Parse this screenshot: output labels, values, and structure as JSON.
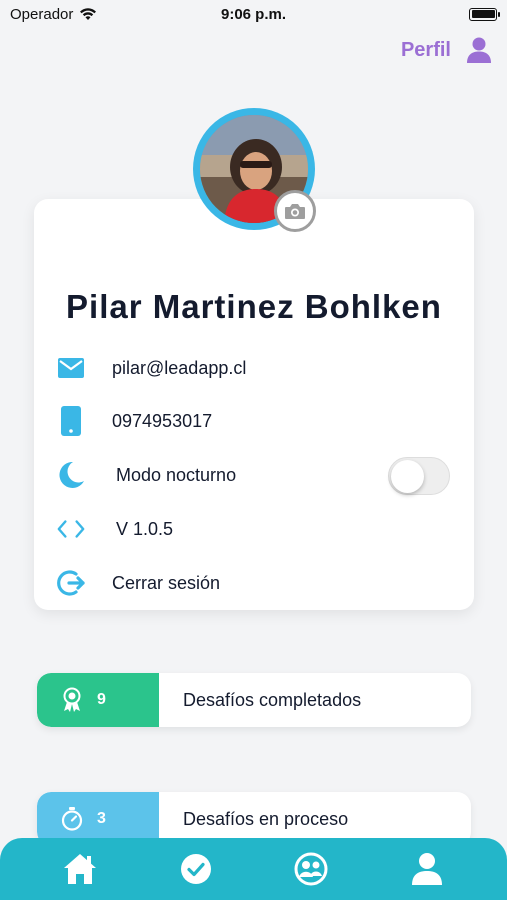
{
  "status_bar": {
    "carrier": "Operador",
    "time": "9:06 p.m."
  },
  "header": {
    "title": "Perfil",
    "accent_color": "#9b6fd4"
  },
  "profile": {
    "name": "Pilar Martinez Bohlken",
    "email": "pilar@leadapp.cl",
    "phone": "0974953017",
    "night_mode_label": "Modo nocturno",
    "night_mode_enabled": false,
    "version": "V 1.0.5",
    "logout_label": "Cerrar sesión",
    "icon_color": "#3ab7e6"
  },
  "stats": [
    {
      "count": "9",
      "label": "Desafíos completados",
      "color": "#2bc48c",
      "icon": "award-icon"
    },
    {
      "count": "3",
      "label": "Desafíos en proceso",
      "color": "#5cc3ea",
      "icon": "timer-icon"
    }
  ],
  "tabbar": {
    "color": "#23b6c9",
    "items": [
      "home-icon",
      "check-icon",
      "community-icon",
      "profile-icon"
    ]
  }
}
